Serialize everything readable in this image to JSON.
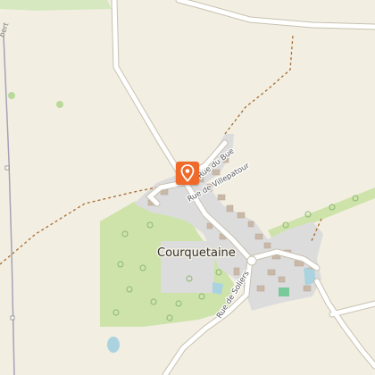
{
  "map": {
    "place_label": "Courquetaine",
    "streets": {
      "rue_du_bue": "Rue du Bue",
      "rue_de_villepatour": "Rue de Villepatour",
      "rue_de_soliers": "Rue de Soliers"
    },
    "edge_label": "bert",
    "marker_icon": "map-pin-icon",
    "colors": {
      "background": "#f2efe2",
      "woodland": "#cde3aa",
      "residential": "#dcdcdc",
      "road": "#ffffff",
      "track": "#a76a30",
      "water": "#aad3df",
      "marker": "#ef6a2a"
    }
  }
}
